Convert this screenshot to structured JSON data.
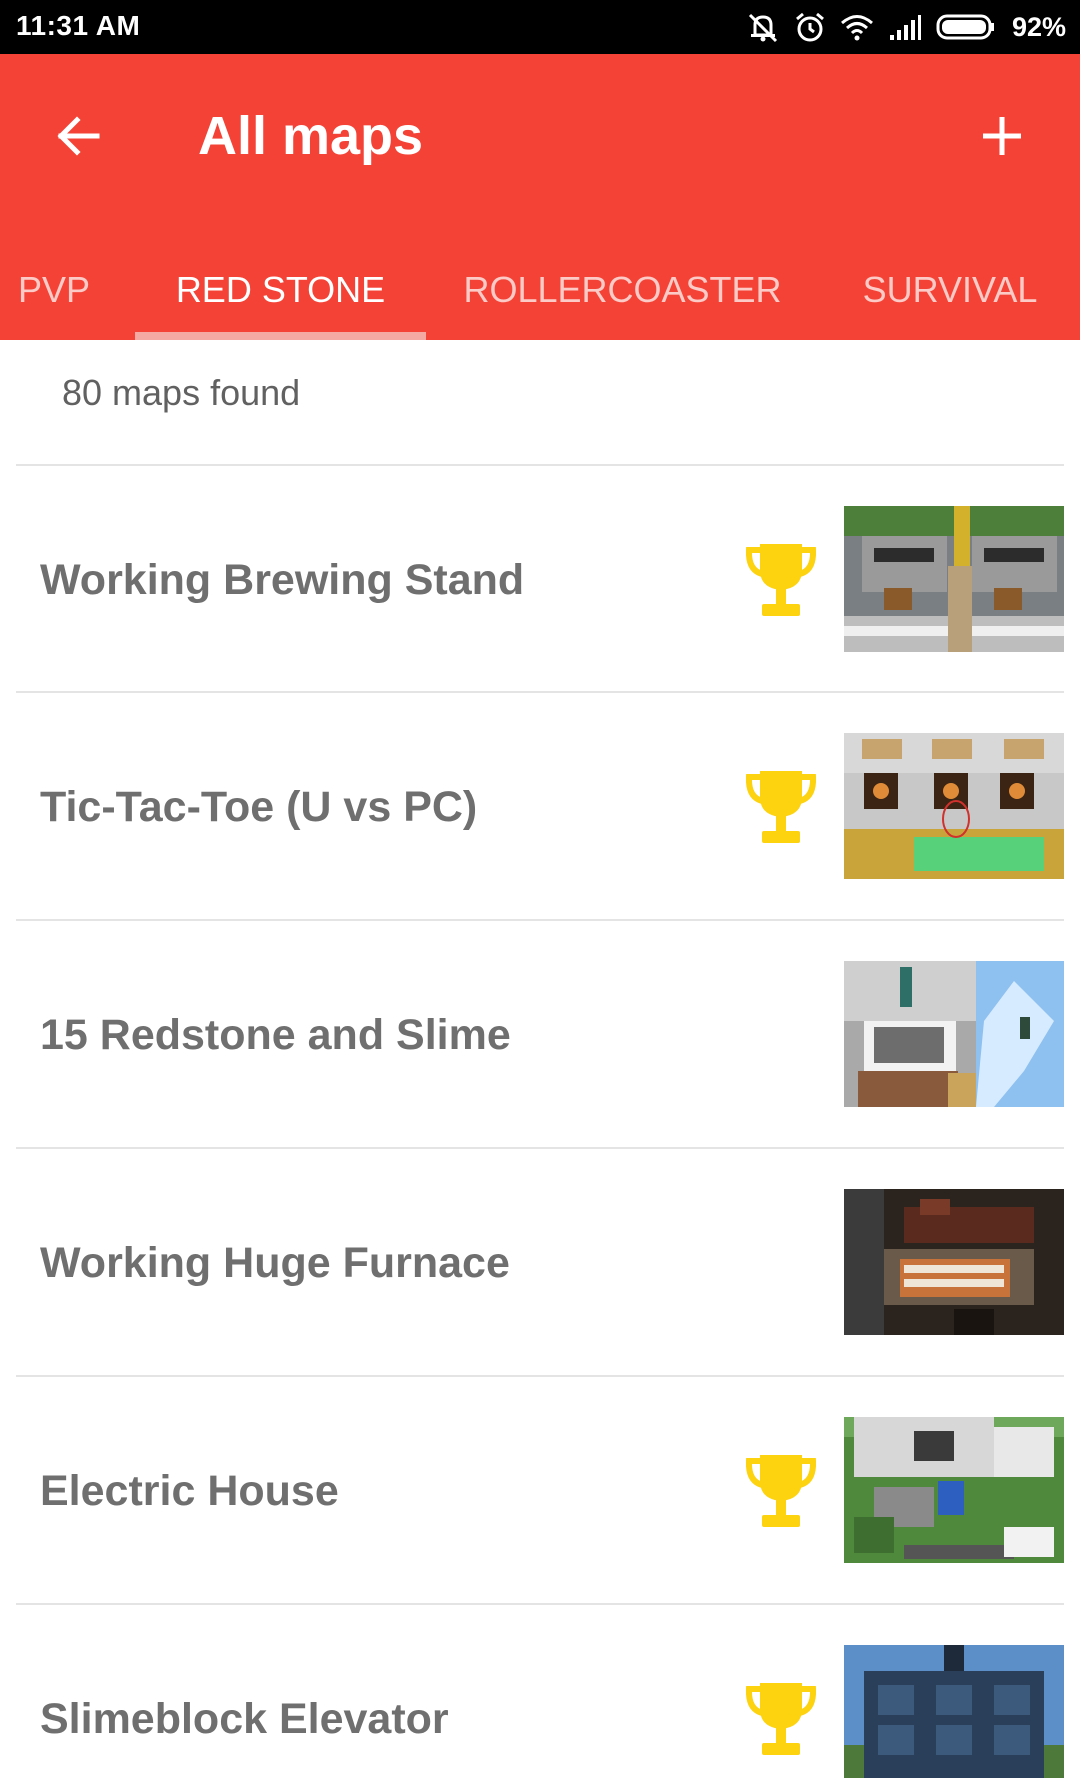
{
  "status_bar": {
    "time": "11:31 AM",
    "battery_percent": "92%",
    "icons": [
      "muted-bell-icon",
      "alarm-icon",
      "wifi-icon",
      "signal-icon",
      "battery-icon"
    ]
  },
  "app_bar": {
    "title": "All maps",
    "back_icon": "arrow-left-icon",
    "add_icon": "plus-icon",
    "color": "#f44336"
  },
  "tabs": [
    {
      "label": "PVP",
      "active": false
    },
    {
      "label": "RED STONE",
      "active": true
    },
    {
      "label": "ROLLERCOASTER",
      "active": false
    },
    {
      "label": "SURVIVAL",
      "active": false
    }
  ],
  "results": {
    "count_text": "80 maps found"
  },
  "maps": [
    {
      "title": "Working Brewing Stand",
      "trophy": true,
      "thumbnail": "brewing-stand-thumbnail"
    },
    {
      "title": "Tic-Tac-Toe (U vs PC)",
      "trophy": true,
      "thumbnail": "tic-tac-toe-thumbnail"
    },
    {
      "title": "15 Redstone and Slime",
      "trophy": false,
      "thumbnail": "redstone-slime-thumbnail"
    },
    {
      "title": "Working Huge Furnace",
      "trophy": false,
      "thumbnail": "huge-furnace-thumbnail"
    },
    {
      "title": "Electric House",
      "trophy": true,
      "thumbnail": "electric-house-thumbnail"
    },
    {
      "title": "Slimeblock Elevator",
      "trophy": true,
      "thumbnail": "slimeblock-elevator-thumbnail"
    }
  ],
  "colors": {
    "accent": "#f44336",
    "trophy": "#fdd20f",
    "row_text": "#6f6f6f"
  }
}
